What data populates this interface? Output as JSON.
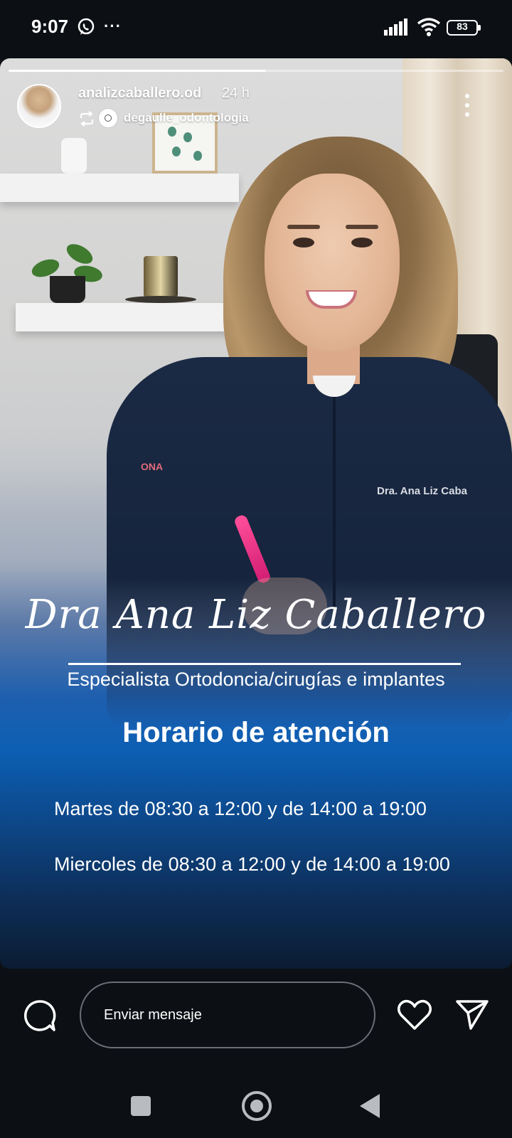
{
  "status_bar": {
    "time": "9:07",
    "notification_icons": [
      "whatsapp-icon",
      "more-dots-icon"
    ],
    "more_dots": "···",
    "system_icons": [
      "signal-icon",
      "wifi-icon",
      "battery-icon"
    ],
    "battery_percent": "83"
  },
  "story": {
    "progress_fraction": 0.52,
    "username": "analizcaballero.od",
    "timestamp": "24 h",
    "repost_from": "degaulle_odontologia",
    "header_icons": [
      "avatar",
      "repost-icon",
      "more-vertical-icon"
    ],
    "doctor_name": "Dra Ana Liz Caballero",
    "specialty": "Especialista Ortodoncia/cirugías e implantes",
    "hours_title": "Horario de atención",
    "schedule": [
      "Martes de 08:30 a 12:00 y de 14:00 a 19:00",
      "Miercoles de 08:30 a 12:00 y de 14:00 a 19:00"
    ],
    "embroidery": "Dra. Ana Liz Caba",
    "sleeve_logo": "ONA"
  },
  "reply_bar": {
    "placeholder": "Enviar mensaje",
    "icons": [
      "comment-icon",
      "heart-icon",
      "send-icon"
    ]
  },
  "nav_bar": {
    "buttons": [
      "recents-button",
      "home-button",
      "back-button"
    ]
  },
  "colors": {
    "background": "#0c0f14",
    "overlay_blue": "#0c5fb4",
    "text": "#ffffff"
  }
}
